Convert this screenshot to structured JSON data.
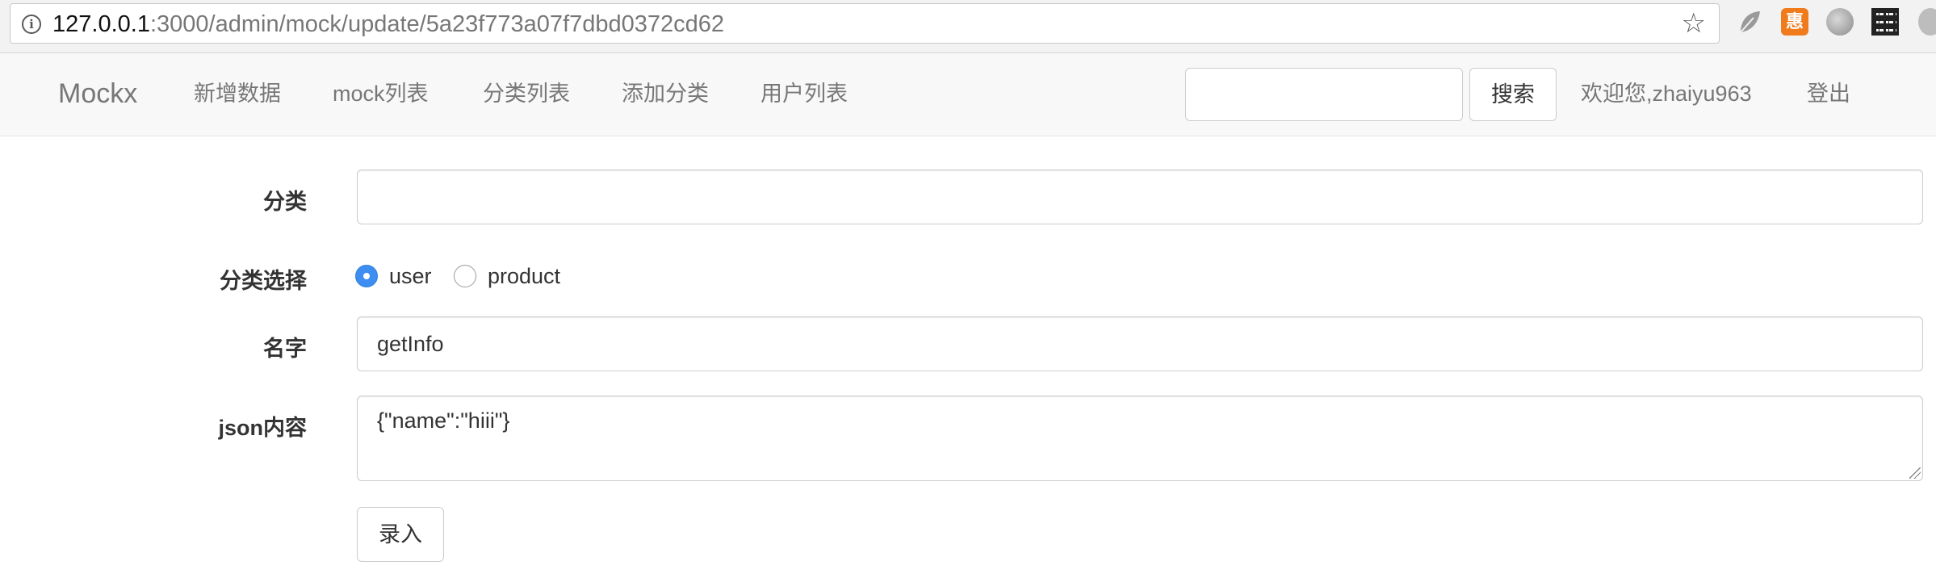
{
  "browser": {
    "url_host": "127.0.0.1",
    "url_path": ":3000/admin/mock/update/5a23f773a07f7dbd0372cd62",
    "icons": [
      "info-icon",
      "star-icon",
      "leaf-extension-icon",
      "orange-extension-icon",
      "globe-extension-icon",
      "qr-code-extension-icon",
      "more-extension-icon"
    ],
    "orange_ext_glyph": "惠"
  },
  "navbar": {
    "brand": "Mockx",
    "links": [
      "新增数据",
      "mock列表",
      "分类列表",
      "添加分类",
      "用户列表"
    ],
    "search": {
      "value": "",
      "placeholder": "",
      "button_label": "搜索"
    },
    "welcome": "欢迎您,zhaiyu963",
    "logout": "登出"
  },
  "form": {
    "category_label": "分类",
    "category_value": "",
    "category_select_label": "分类选择",
    "category_options": [
      {
        "label": "user",
        "checked": true
      },
      {
        "label": "product",
        "checked": false
      }
    ],
    "name_label": "名字",
    "name_value": "getInfo",
    "json_label": "json内容",
    "json_value": "{\"name\":\"hiii\"}",
    "submit_label": "录入"
  },
  "colors": {
    "radio_accent": "#3d8ef0",
    "navbar_bg": "#f8f8f8",
    "orange_ext": "#f07b1c"
  }
}
